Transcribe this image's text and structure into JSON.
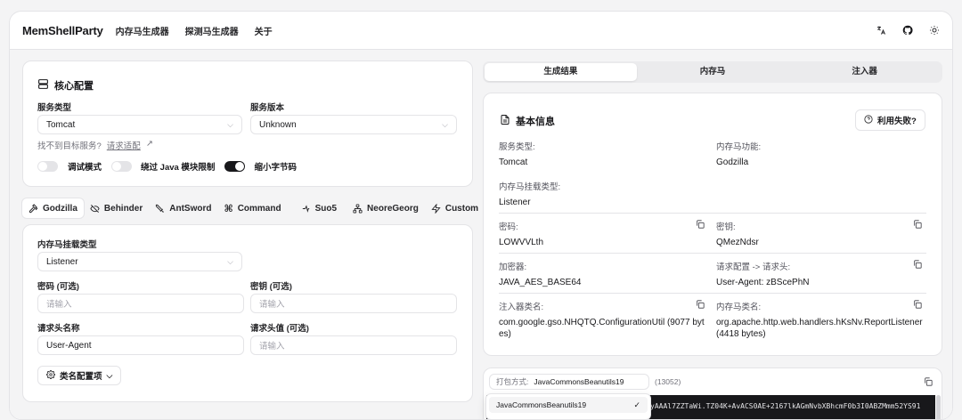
{
  "navbar": {
    "brand": "MemShellParty",
    "links": [
      "内存马生成器",
      "探测马生成器",
      "关于"
    ]
  },
  "core_config": {
    "title": "核心配置",
    "server_type_label": "服务类型",
    "server_type_value": "Tomcat",
    "server_version_label": "服务版本",
    "server_version_value": "Unknown",
    "not_found_text": "找不到目标服务?",
    "request_adapt_link": "请求适配",
    "debug_mode_label": "调试模式",
    "bypass_java_label": "绕过 Java 模块限制",
    "shrink_bytes_label": "缩小字节码"
  },
  "shell_tabs": [
    "Godzilla",
    "Behinder",
    "AntSword",
    "Command",
    "Suo5",
    "NeoreGeorg",
    "Custom"
  ],
  "shell_config": {
    "mount_type_label": "内存马挂载类型",
    "mount_type_value": "Listener",
    "password_label": "密码 (可选)",
    "password_placeholder": "请输入",
    "key_label": "密钥 (可选)",
    "key_placeholder": "请输入",
    "header_name_label": "请求头名称",
    "header_name_value": "User-Agent",
    "header_value_label": "请求头值 (可选)",
    "header_value_placeholder": "请输入",
    "class_name_btn": "类名配置项"
  },
  "result_tabs": [
    "生成结果",
    "内存马",
    "注入器"
  ],
  "basic_info": {
    "title": "基本信息",
    "fail_btn": "利用失败?",
    "server_type_label": "服务类型:",
    "server_type_value": "Tomcat",
    "shell_func_label": "内存马功能:",
    "shell_func_value": "Godzilla",
    "mount_type_label": "内存马挂载类型:",
    "mount_type_value": "Listener",
    "password_label": "密码:",
    "password_value": "LOWVVLth",
    "key_label": "密钥:",
    "key_value": "QMezNdsr",
    "encryptor_label": "加密器:",
    "encryptor_value": "JAVA_AES_BASE64",
    "request_config_label": "请求配置 -> 请求头:",
    "request_config_value": "User-Agent: zBScePhN",
    "injector_class_label": "注入器类名:",
    "injector_class_value_1": "com.google.gso.NHQTQ.ConfigurationUtil (9077 byt",
    "injector_class_value_2": "es)",
    "shell_class_label": "内存马类名:",
    "shell_class_value_1": "org.apache.http.web.handlers.hKsNv.ReportListener",
    "shell_class_value_2": "(4418 bytes)"
  },
  "packing": {
    "label": "打包方式:",
    "value": "JavaCommonsBeanutils19",
    "size": "(13052)",
    "dropdown_option": "JavaCommonsBeanutils19",
    "code_snippet": "yAAAl7ZZTaWi.TZ04K+AvACS0AE+2167lkAGmNvbXBhcmF0b3I0ABZMmm52YS91"
  }
}
